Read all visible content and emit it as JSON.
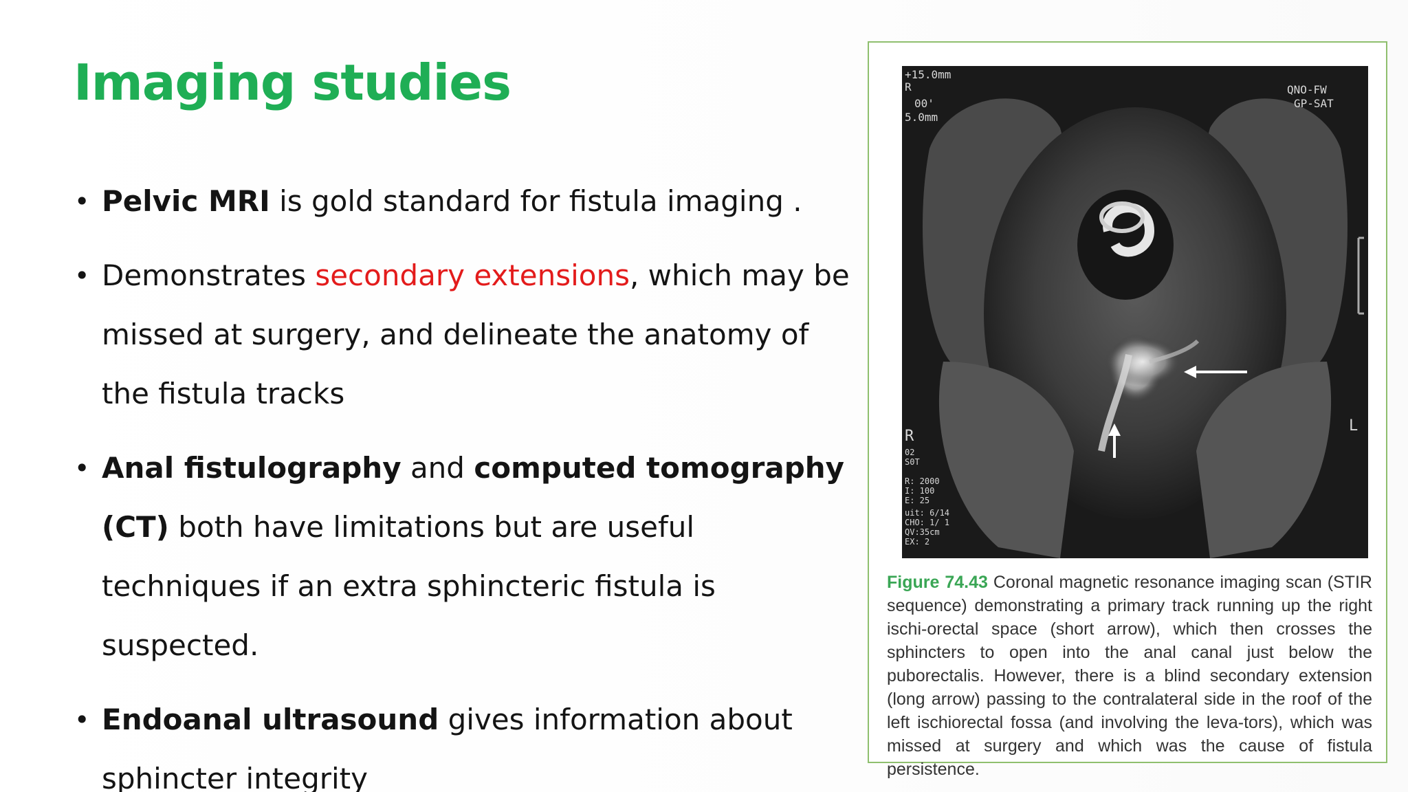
{
  "slide": {
    "title": "Imaging studies",
    "bullets": [
      {
        "parts": [
          {
            "text": "Pelvic MRI",
            "style": "bold"
          },
          {
            "text": " is gold standard for fistula imaging .",
            "style": "normal"
          }
        ]
      },
      {
        "parts": [
          {
            "text": "Demonstrates ",
            "style": "normal"
          },
          {
            "text": "secondary extensions",
            "style": "red"
          },
          {
            "text": ", which may be missed at surgery, and delineate the anatomy of the fistula tracks",
            "style": "normal"
          }
        ]
      },
      {
        "parts": [
          {
            "text": "Anal fistulography",
            "style": "bold"
          },
          {
            "text": " and ",
            "style": "normal"
          },
          {
            "text": "computed tomography (CT)",
            "style": "bold"
          },
          {
            "text": " both have limitations but are useful techniques if an extra sphincteric fistula is suspected.",
            "style": "normal"
          }
        ]
      },
      {
        "parts": [
          {
            "text": "Endoanal ultrasound",
            "style": "bold"
          },
          {
            "text": " gives information about sphincter integrity",
            "style": "normal"
          }
        ]
      }
    ]
  },
  "figure": {
    "label": "Figure 74.43",
    "caption": " Coronal magnetic resonance imaging scan (STIR sequence) demonstrating a primary track running up the right ischi-orectal space (short arrow), which then crosses the sphincters to open into the anal canal just below the puborectalis. However, there is a blind secondary extension (long arrow) passing to the contralateral side in the roof of the left ischiorectal fossa (and involving the leva-tors), which was missed at surgery and which was the cause of fistula persistence.",
    "mri_overlay": {
      "top_left": [
        "+15.0mm",
        "R",
        "00'",
        "5.0mm"
      ],
      "top_right": [
        "QNO-FW",
        "GP-SAT"
      ],
      "side_right": "L",
      "side_left": "R",
      "bottom_left": [
        "02",
        "S0T",
        "R: 2000",
        "I: 100",
        "E: 25",
        "uit: 6/14",
        "CHO: 1/ 1",
        "QV:35cm",
        "EX: 2"
      ]
    },
    "colors": {
      "label": "#3aa655",
      "border": "#8fbf6e"
    }
  }
}
